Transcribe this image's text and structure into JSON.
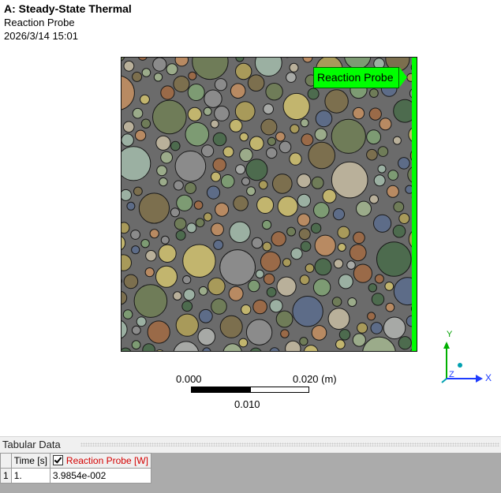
{
  "header": {
    "title": "A: Steady-State Thermal",
    "object": "Reaction Probe",
    "timestamp": "2026/3/14 15:01"
  },
  "viewport": {
    "probe_label": "Reaction Probe",
    "highlight_color": "#00ff00"
  },
  "scale": {
    "left": "0.000",
    "right": "0.020 (m)",
    "mid": "0.010"
  },
  "triad": {
    "x": "X",
    "y": "Y",
    "z": "Z"
  },
  "tabular": {
    "title": "Tabular Data",
    "columns": [
      "Time [s]",
      "Reaction Probe [W]"
    ],
    "rows": [
      {
        "index": "1",
        "time": "1.",
        "value": "3.9854e-002"
      }
    ]
  }
}
